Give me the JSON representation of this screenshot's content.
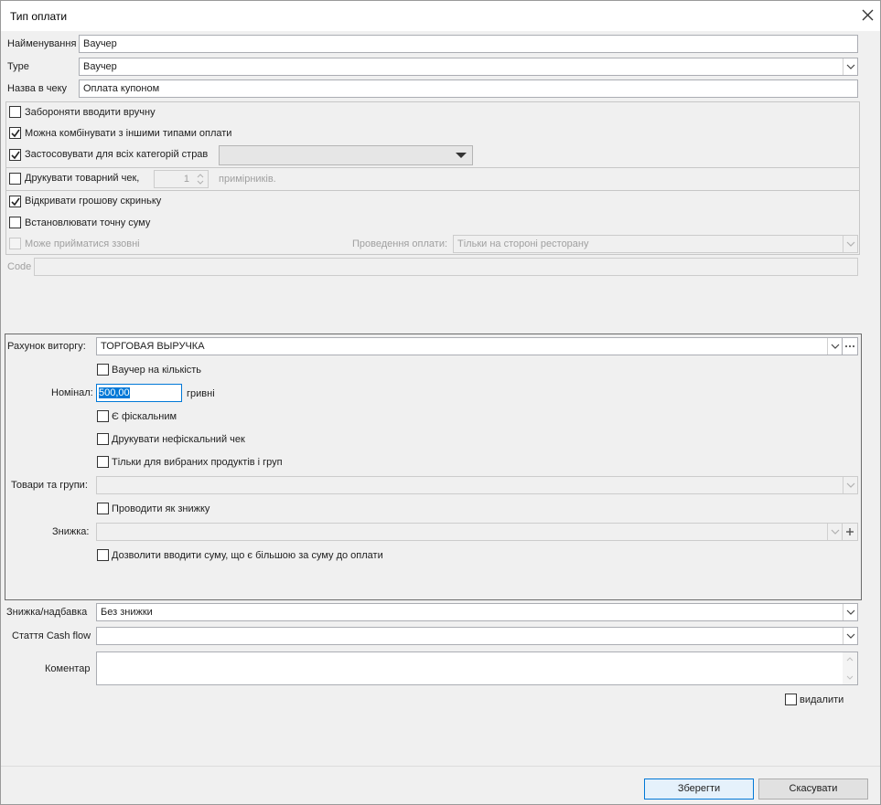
{
  "window": {
    "title": "Тип оплати"
  },
  "top_fields": {
    "name_label": "Найменування",
    "name_value": "Ваучер",
    "type_label": "Type",
    "type_value": "Ваучер",
    "receipt_label": "Назва в чеку",
    "receipt_value": "Оплата купоном"
  },
  "options": {
    "forbid_manual": {
      "label": "Забороняти вводити вручну",
      "checked": false
    },
    "combine": {
      "label": "Можна комбінувати з іншими типами оплати",
      "checked": true
    },
    "apply_all": {
      "label": "Застосовувати для всіх категорій страв",
      "checked": true,
      "category_value": ""
    },
    "print_receipt": {
      "label": "Друкувати товарний чек,",
      "checked": false,
      "copies": "1",
      "copies_suffix": "примірників."
    },
    "open_drawer": {
      "label": "Відкривати грошову скриньку",
      "checked": true
    },
    "exact_sum": {
      "label": "Встановлювати точну суму",
      "checked": false
    },
    "external": {
      "label": "Може прийматися ззовні",
      "checked": false,
      "disabled": true
    },
    "processing_label": "Проведення оплати:",
    "processing_value": "Тільки на стороні ресторану"
  },
  "code": {
    "label": "Code",
    "value": ""
  },
  "revenue_panel": {
    "account_label": "Рахунок виторгу:",
    "account_value": "ТОРГОВАЯ ВЫРУЧКА",
    "voucher_qty": {
      "label": "Ваучер на кількість",
      "checked": false
    },
    "nominal_label": "Номінал:",
    "nominal_value": "500,00",
    "nominal_unit": "гривні",
    "fiscal": {
      "label": "Є фіскальним",
      "checked": false
    },
    "print_nonfiscal": {
      "label": "Друкувати нефіскальний чек",
      "checked": false
    },
    "only_selected": {
      "label": "Тільки для вибраних продуктів і груп",
      "checked": false
    },
    "goods_label": "Товари та групи:",
    "goods_value": "",
    "as_discount": {
      "label": "Проводити як знижку",
      "checked": false
    },
    "discount_label": "Знижка:",
    "discount_value": "",
    "allow_greater": {
      "label": "Дозволити вводити суму, що є більшою за суму до оплати",
      "checked": false
    }
  },
  "bottom": {
    "discount_label": "Знижка/надбавка",
    "discount_value": "Без знижки",
    "cashflow_label": "Стаття Cash flow",
    "cashflow_value": "",
    "comment_label": "Коментар",
    "comment_value": "",
    "delete": {
      "label": "видалити",
      "checked": false
    }
  },
  "buttons": {
    "save": "Зберегти",
    "cancel": "Скасувати"
  },
  "colors": {
    "accent": "#0078d7",
    "dialog_bg": "#f0f0f0"
  }
}
